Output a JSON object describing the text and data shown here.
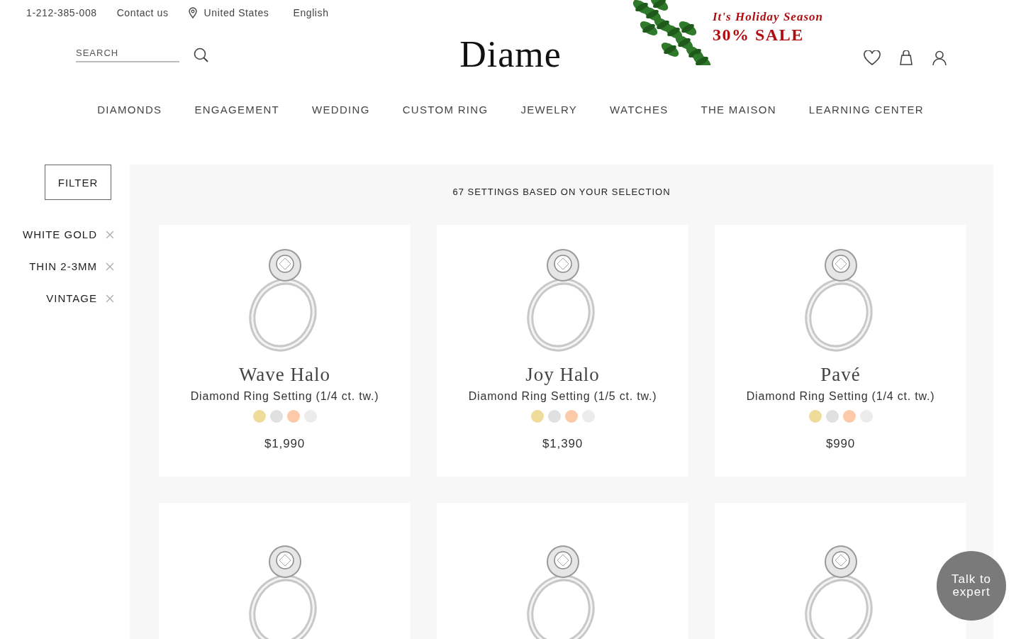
{
  "top_bar": {
    "phone": "1-212-385-008",
    "contact": "Contact us",
    "location": "United States",
    "language": "English"
  },
  "promo": {
    "title": "It's Holiday Season",
    "sale": "30% SALE"
  },
  "header": {
    "search_placeholder": "SEARCH",
    "logo": "Diame"
  },
  "nav": [
    "DIAMONDS",
    "ENGAGEMENT",
    "WEDDING",
    "CUSTOM RING",
    "JEWELRY",
    "WATCHES",
    "THE MAISON",
    "LEARNING CENTER"
  ],
  "filter": {
    "button": "FILTER",
    "tags": [
      "WHITE GOLD",
      "THIN 2-3MM",
      "VINTAGE"
    ]
  },
  "results": {
    "summary": "67 SETTINGS BASED ON YOUR SELECTION"
  },
  "products": [
    {
      "kind": "full",
      "name": "Wave Halo",
      "description": "Diamond Ring Setting (1/4 ct. tw.)",
      "price": "$1,990",
      "swatches": [
        {
          "color": "#f0dc9a"
        },
        {
          "color": "#e0e0e0"
        },
        {
          "color": "#fccaa8"
        },
        {
          "color": "#ececec"
        }
      ]
    },
    {
      "kind": "full",
      "name": "Joy Halo",
      "description": "Diamond Ring Setting (1/5 ct. tw.)",
      "price": "$1,390",
      "swatches": [
        {
          "color": "#f0dc9a"
        },
        {
          "color": "#e0e0e0"
        },
        {
          "color": "#fccaa8"
        },
        {
          "color": "#ececec"
        }
      ]
    },
    {
      "kind": "full",
      "name": "Pavé",
      "description": "Diamond Ring Setting (1/4 ct. tw.)",
      "price": "$990",
      "swatches": [
        {
          "color": "#f0dc9a"
        },
        {
          "color": "#e0e0e0"
        },
        {
          "color": "#fccaa8"
        },
        {
          "color": "#ececec"
        }
      ]
    },
    {
      "kind": "image_only"
    },
    {
      "kind": "image_only"
    },
    {
      "kind": "image_only"
    }
  ],
  "chat_button": "Talk to expert"
}
